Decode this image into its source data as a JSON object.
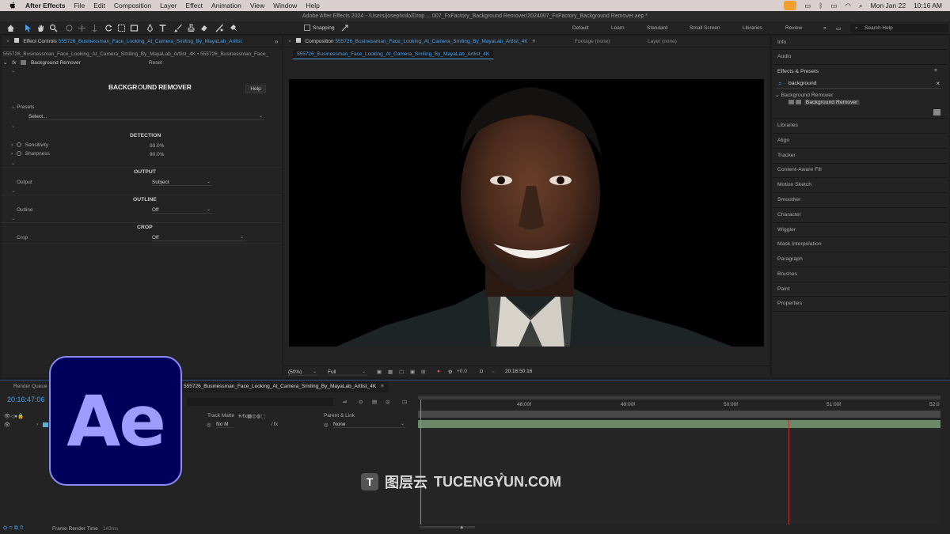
{
  "menubar": {
    "app": "After Effects",
    "items": [
      "File",
      "Edit",
      "Composition",
      "Layer",
      "Effect",
      "Animation",
      "View",
      "Window",
      "Help"
    ],
    "date": "Mon Jan 22",
    "time": "10:16 AM"
  },
  "window_title": "Adobe After Effects 2024 - /Users/josephnilo/Drop ... 007_FxFactory_Background Remover/2024007_FxFactory_Background Remover.aep *",
  "toolbar": {
    "snapping_label": "Snapping",
    "workspaces": [
      "Default",
      "Learn",
      "Standard",
      "Small Screen",
      "Libraries",
      "Review"
    ],
    "search_placeholder": "Search Help"
  },
  "effect_controls": {
    "tab_label": "Effect Controls",
    "tab_layer": "555726_Businessman_Face_Looking_At_Camera_Smiling_By_MayaLab_Artlist",
    "path": "555726_Businessman_Face_Looking_At_Camera_Smiling_By_MayaLab_Artlist_4K • 555726_Businessman_Face_",
    "fx_label": "fx",
    "effect_name": "Background Remover",
    "reset_label": "Reset",
    "logo_text_a": "BACKGR",
    "logo_text_b": "UND REMOVER",
    "help_label": "Help",
    "presets_label": "Presets",
    "presets_value": "Select...",
    "detection_header": "DETECTION",
    "sensitivity_label": "Sensitivity",
    "sensitivity_value": "90.0%",
    "sharpness_label": "Sharpness",
    "sharpness_value": "90.0%",
    "output_header": "OUTPUT",
    "output_label": "Output",
    "output_value": "Subject",
    "outline_header": "OUTLINE",
    "outline_label": "Outline",
    "outline_value": "Off",
    "crop_header": "CROP",
    "crop_label": "Crop",
    "crop_value": "Off"
  },
  "composition": {
    "tab_label": "Composition",
    "tab_name": "555726_Businessman_Face_Looking_At_Camera_Smiling_By_MayaLab_Artlist_4K",
    "footage_label": "Footage (none)",
    "layer_label": "Layer (none)",
    "subtab": "555726_Businessman_Face_Looking_At_Camera_Smiling_By_MayaLab_Artlist_4K",
    "zoom": "(50%)",
    "resolution": "Full",
    "exposure": "+0.0",
    "timecode": "20:16:50:16"
  },
  "right_panel": {
    "info": "Info",
    "audio": "Audio",
    "effects_presets": "Effects & Presets",
    "search_value": "background",
    "category": "Background Remover",
    "effect_item": "Background Remover",
    "items": [
      "Libraries",
      "Align",
      "Tracker",
      "Content-Aware Fill",
      "Motion Sketch",
      "Smoother",
      "Character",
      "Wiggler",
      "Mask Interpolation",
      "Paragraph",
      "Brushes",
      "Paint",
      "Properties"
    ]
  },
  "timeline": {
    "render_queue": "Render Queue",
    "comp_tab": "555726_Businessman_Face_Looking_At_Camera_Smiling_By_MayaLab_Artlist_4K",
    "timecode": "20:16:47:06",
    "track_matte": "Track Matte",
    "parent_link": "Parent & Link",
    "matte_value": "No M",
    "parent_value": "None",
    "ruler_labels": [
      "48:00f",
      "49:00f",
      "50:00f",
      "51:00f",
      "52:0"
    ],
    "frame_render_label": "Frame Render Time",
    "frame_render_value": "143ms"
  },
  "ae_logo_text": "Ae",
  "watermark": {
    "badge": "T",
    "cn": "图层云",
    "en": "TUCENGYUN.COM"
  }
}
